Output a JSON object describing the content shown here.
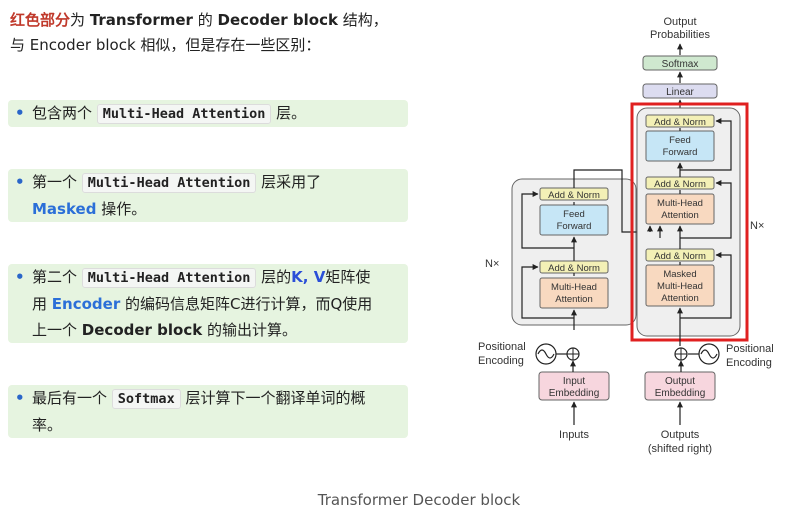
{
  "intro": {
    "red": "红色部分",
    "t1": "为",
    "b1": "Transformer",
    "t2": "的",
    "b2": "Decoder block",
    "t3": "结构，",
    "line2": "与 Encoder block 相似，但是存在一些区别："
  },
  "bullets": [
    {
      "pre": "包含两个",
      "code": "Multi-Head Attention",
      "post": "层。"
    },
    {
      "pre": "第一个",
      "code": "Multi-Head Attention",
      "post": "层采用了",
      "blue": "Masked",
      "post2": "操作。"
    },
    {
      "pre": "第二个",
      "code": "Multi-Head Attention",
      "post": "层的",
      "kv": "K, V",
      "post2": "矩阵使",
      "line2pre": "用",
      "enc": "Encoder",
      "line2post": "的编码信息矩阵C进行计算，而Q使用",
      "line3pre": "上一个",
      "line3b": "Decoder block",
      "line3post": "的输出计算。"
    },
    {
      "pre": "最后有一个",
      "code": "Softmax",
      "post": "层计算下一个翻译单词的概",
      "line2": "率。"
    }
  ],
  "diagram": {
    "output_probabilities": [
      "Output",
      "Probabilities"
    ],
    "softmax": "Softmax",
    "linear": "Linear",
    "add_norm": "Add & Norm",
    "feed_forward": [
      "Feed",
      "Forward"
    ],
    "multi_head_attention": [
      "Multi-Head",
      "Attention"
    ],
    "masked_mha": [
      "Masked",
      "Multi-Head",
      "Attention"
    ],
    "nx": "N×",
    "positional_encoding": [
      "Positional",
      "Encoding"
    ],
    "input_embedding": [
      "Input",
      "Embedding"
    ],
    "output_embedding": [
      "Output",
      "Embedding"
    ],
    "inputs": "Inputs",
    "outputs": [
      "Outputs",
      "(shifted right)"
    ],
    "colors": {
      "add_norm": "#f3f0b6",
      "feed_forward": "#c6e6f6",
      "attention": "#f8d9c0",
      "linear": "#dcdcf0",
      "softmax": "#cfe8cf",
      "embedding": "#f7d6de",
      "highlight": "#e02020"
    }
  },
  "caption": "Transformer Decoder block"
}
